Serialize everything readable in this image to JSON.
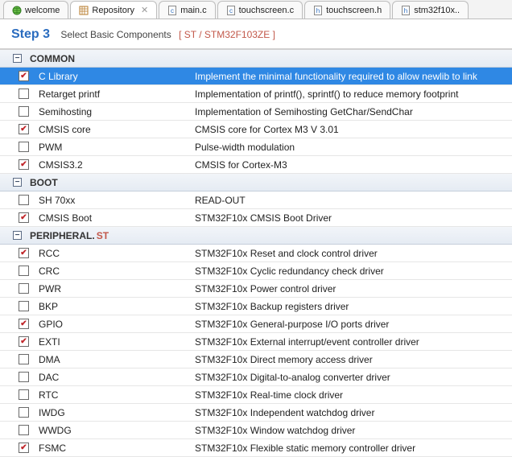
{
  "tabs": [
    {
      "label": "welcome",
      "icon": "globe"
    },
    {
      "label": "Repository",
      "icon": "grid",
      "active": true
    },
    {
      "label": "main.c",
      "icon": "cfile"
    },
    {
      "label": "touchscreen.c",
      "icon": "cfile"
    },
    {
      "label": "touchscreen.h",
      "icon": "hfile"
    },
    {
      "label": "stm32f10x..",
      "icon": "hfile"
    }
  ],
  "step": {
    "num": "Step 3",
    "subtitle": "Select Basic Components",
    "path": "[ ST / STM32F103ZE ]"
  },
  "groups": [
    {
      "title": "COMMON",
      "suffix": "",
      "items": [
        {
          "name": "C Library",
          "desc": "Implement the minimal functionality required to allow newlib to link",
          "checked": true,
          "selected": true
        },
        {
          "name": "Retarget printf",
          "desc": "Implementation of printf(), sprintf() to reduce memory footprint",
          "checked": false
        },
        {
          "name": "Semihosting",
          "desc": "Implementation of Semihosting GetChar/SendChar",
          "checked": false
        },
        {
          "name": "CMSIS core",
          "desc": "CMSIS core for Cortex M3 V 3.01",
          "checked": true
        },
        {
          "name": "PWM",
          "desc": "Pulse-width modulation",
          "checked": false
        },
        {
          "name": "CMSIS3.2",
          "desc": "CMSIS for Cortex-M3",
          "checked": true
        }
      ]
    },
    {
      "title": "BOOT",
      "suffix": "",
      "items": [
        {
          "name": "SH 70xx",
          "desc": "READ-OUT",
          "checked": false
        },
        {
          "name": "CMSIS Boot",
          "desc": "STM32F10x CMSIS Boot Driver",
          "checked": true
        }
      ]
    },
    {
      "title": "PERIPHERAL.",
      "suffix": "ST",
      "items": [
        {
          "name": "RCC",
          "desc": "STM32F10x Reset and clock control driver",
          "checked": true
        },
        {
          "name": "CRC",
          "desc": "STM32F10x Cyclic redundancy check driver",
          "checked": false
        },
        {
          "name": "PWR",
          "desc": "STM32F10x Power control driver",
          "checked": false
        },
        {
          "name": "BKP",
          "desc": "STM32F10x Backup registers driver",
          "checked": false
        },
        {
          "name": "GPIO",
          "desc": "STM32F10x General-purpose I/O ports driver",
          "checked": true
        },
        {
          "name": "EXTI",
          "desc": "STM32F10x External interrupt/event controller driver",
          "checked": true
        },
        {
          "name": "DMA",
          "desc": "STM32F10x Direct memory access driver",
          "checked": false
        },
        {
          "name": "DAC",
          "desc": "STM32F10x Digital-to-analog converter driver",
          "checked": false
        },
        {
          "name": "RTC",
          "desc": "STM32F10x Real-time clock driver",
          "checked": false
        },
        {
          "name": "IWDG",
          "desc": "STM32F10x Independent watchdog driver",
          "checked": false
        },
        {
          "name": "WWDG",
          "desc": "STM32F10x Window watchdog driver",
          "checked": false
        },
        {
          "name": "FSMC",
          "desc": "STM32F10x Flexible static memory controller driver",
          "checked": true
        }
      ]
    }
  ]
}
